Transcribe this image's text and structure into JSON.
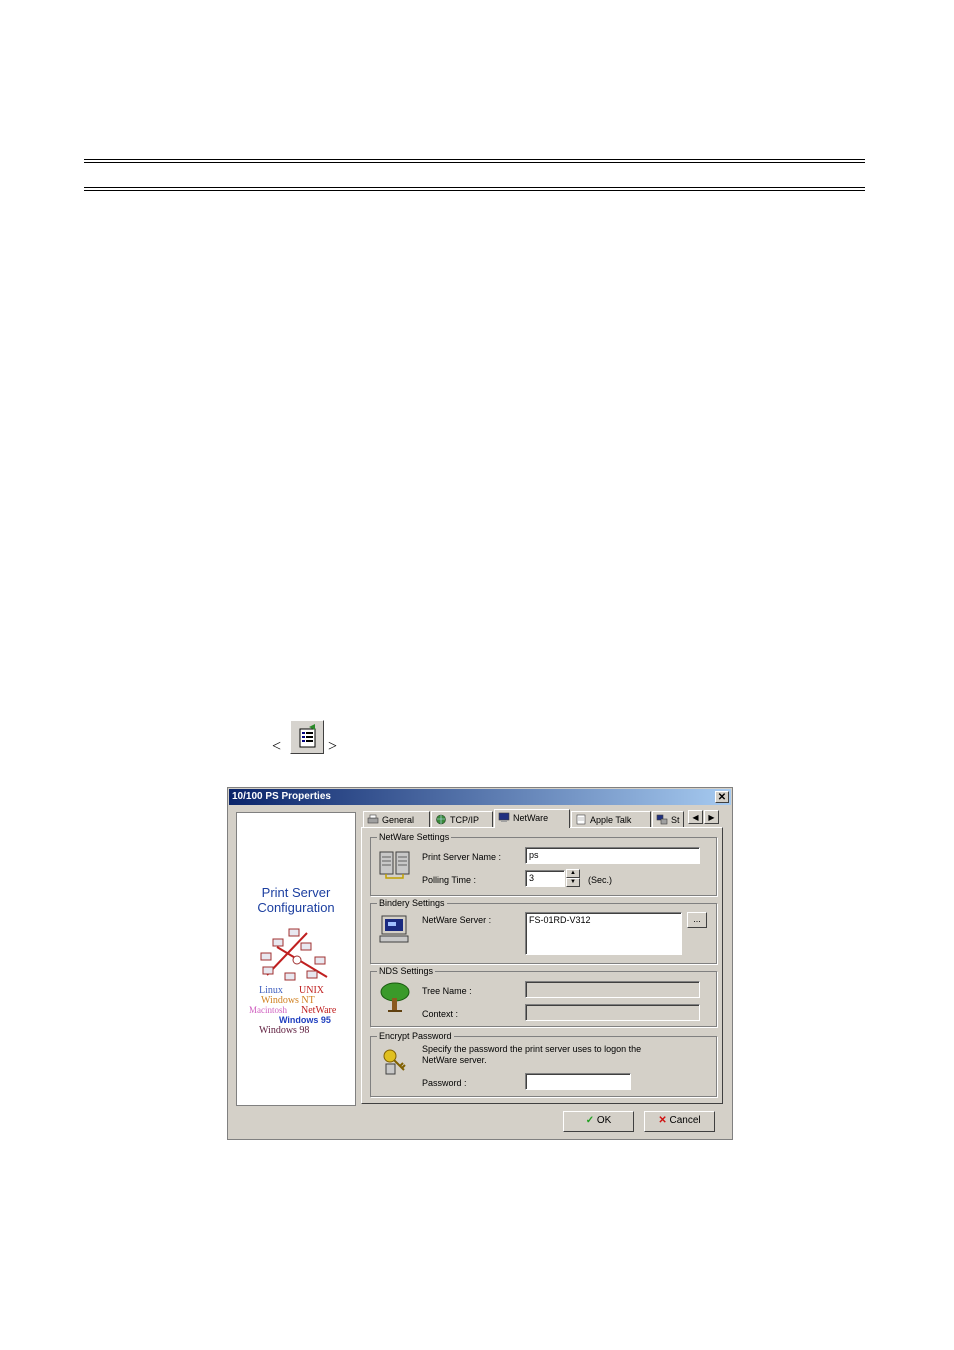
{
  "dialog": {
    "title": "10/100 PS Properties",
    "close_glyph": "✕"
  },
  "logo": {
    "title_line1": "Print Server",
    "title_line2": "Configuration",
    "os": [
      "Linux",
      "UNIX",
      "Windows NT",
      "Macintosh",
      "NetWare",
      "Windows 95",
      "Windows 98"
    ]
  },
  "tabs": [
    {
      "label": "General",
      "icon": "printer-wrench-icon"
    },
    {
      "label": "TCP/IP",
      "icon": "globe-icon"
    },
    {
      "label": "NetWare",
      "icon": "computer-icon",
      "active": true
    },
    {
      "label": "Apple Talk",
      "icon": "document-icon"
    },
    {
      "label": "St",
      "icon": "network-icon"
    }
  ],
  "netware_settings": {
    "legend": "NetWare Settings",
    "print_server_name_label": "Print Server Name :",
    "print_server_name_value": "ps",
    "polling_time_label": "Polling Time :",
    "polling_time_value": "3",
    "polling_time_unit": "(Sec.)"
  },
  "bindery_settings": {
    "legend": "Bindery Settings",
    "netware_server_label": "NetWare Server :",
    "netware_server_value": "FS-01RD-V312",
    "browse_label": "..."
  },
  "nds_settings": {
    "legend": "NDS Settings",
    "tree_name_label": "Tree Name :",
    "tree_name_value": "",
    "context_label": "Context :",
    "context_value": ""
  },
  "encrypt_password": {
    "legend": "Encrypt Password",
    "description_line1": "Specify the password the print server uses to logon the",
    "description_line2": "NetWare server.",
    "password_label": "Password :",
    "password_value": ""
  },
  "buttons": {
    "ok": "OK",
    "cancel": "Cancel"
  },
  "colors": {
    "titlebar_start": "#0a246a",
    "dialog_face": "#d4d0c8",
    "logo_title": "#1c3fa0"
  }
}
